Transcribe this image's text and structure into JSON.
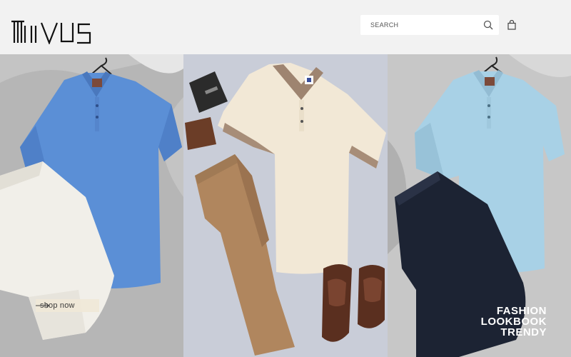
{
  "brand": {
    "logo_text": "MIVUS",
    "logo_icon": "brand-logo"
  },
  "search": {
    "placeholder": "SEARCH",
    "icon": "search-icon"
  },
  "cart": {
    "icon": "shopping-bag-icon"
  },
  "banner": {
    "panels": [
      {
        "name": "blue-polo-with-white-shorts"
      },
      {
        "name": "cream-polo-with-khaki-pants-and-loafers"
      },
      {
        "name": "light-blue-polo-with-navy-shorts"
      }
    ],
    "cta": {
      "label": "shop now",
      "icon": "arrow-right-icon"
    },
    "headline": [
      "FASHION",
      "LOOKBOOK",
      "TRENDY"
    ]
  },
  "colors": {
    "header_bg": "#f2f2f2",
    "cta_bg": "#f0e8d7",
    "headline": "#ffffff"
  }
}
